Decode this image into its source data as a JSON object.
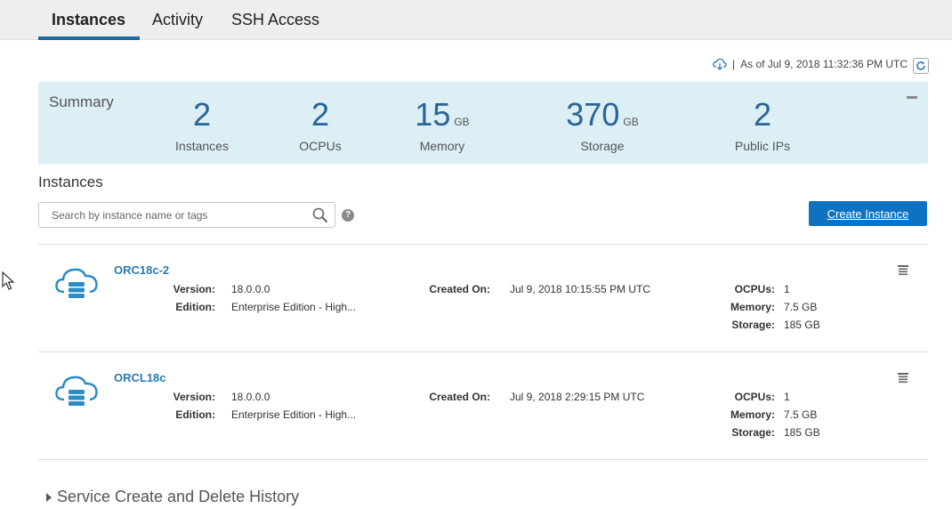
{
  "tabs": [
    {
      "label": "Instances",
      "active": true
    },
    {
      "label": "Activity",
      "active": false
    },
    {
      "label": "SSH Access",
      "active": false
    }
  ],
  "status": {
    "separator": "|",
    "as_of": "As of Jul 9, 2018 11:32:36 PM UTC"
  },
  "summary": {
    "title": "Summary",
    "stats": [
      {
        "value": "2",
        "unit": "",
        "label": "Instances"
      },
      {
        "value": "2",
        "unit": "",
        "label": "OCPUs"
      },
      {
        "value": "15",
        "unit": "GB",
        "label": "Memory"
      },
      {
        "value": "370",
        "unit": "GB",
        "label": "Storage"
      },
      {
        "value": "2",
        "unit": "",
        "label": "Public IPs"
      }
    ]
  },
  "instances_section": {
    "title": "Instances",
    "search_placeholder": "Search by instance name or tags",
    "help": "?",
    "create_label": "Create Instance"
  },
  "labels": {
    "version": "Version:",
    "edition": "Edition:",
    "created_on": "Created On:",
    "ocpus": "OCPUs:",
    "memory": "Memory:",
    "storage": "Storage:"
  },
  "instances": [
    {
      "name": "ORC18c-2",
      "version": "18.0.0.0",
      "edition": "Enterprise Edition - High...",
      "created_on": "Jul 9, 2018 10:15:55 PM UTC",
      "ocpus": "1",
      "memory": "7.5 GB",
      "storage": "185 GB"
    },
    {
      "name": "ORCL18c",
      "version": "18.0.0.0",
      "edition": "Enterprise Edition - High...",
      "created_on": "Jul 9, 2018 2:29:15 PM UTC",
      "ocpus": "1",
      "memory": "7.5 GB",
      "storage": "185 GB"
    }
  ],
  "history": {
    "label": "Service Create and Delete History"
  },
  "colors": {
    "accent": "#0f72c1",
    "summary_bg": "#dbeff4",
    "link": "#2a7ab0"
  },
  "icons": [
    "cloud-download-icon",
    "refresh-icon",
    "collapse-icon",
    "search-icon",
    "help-icon",
    "database-cloud-icon",
    "hamburger-menu-icon",
    "expand-caret-icon",
    "mouse-cursor-icon"
  ]
}
